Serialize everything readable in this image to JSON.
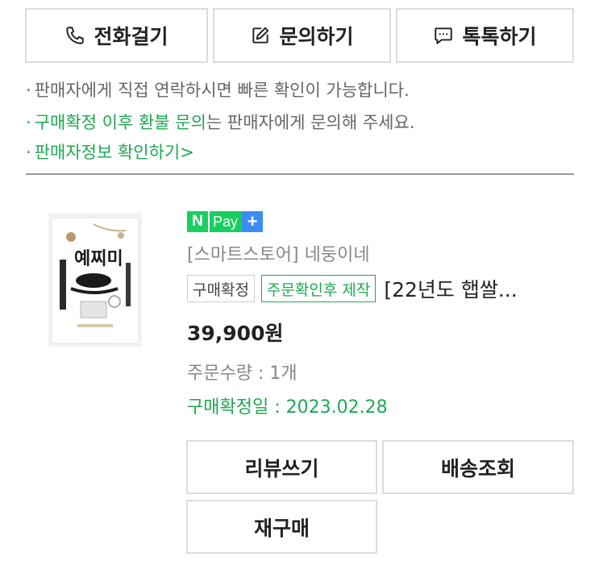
{
  "top_actions": {
    "call_label": "전화걸기",
    "inquiry_label": "문의하기",
    "talktalk_label": "톡톡하기"
  },
  "notes": {
    "line1": "판매자에게 직접 연락하시면 빠른 확인이 가능합니다.",
    "line2_highlight": "구매확정 이후 환불 문의",
    "line2_rest": "는 판매자에게 문의해 주세요.",
    "seller_info_link": "판매자정보 확인하기",
    "bullet": "·",
    "chevron": ">"
  },
  "order": {
    "npay_n": "N",
    "npay_pay": "Pay",
    "npay_plus": "+",
    "store": "[스마트스토어] 네둥이네",
    "badge_confirmed": "구매확정",
    "badge_made_to_order": "주문확인후 제작",
    "product_title": "[22년도 햅쌀...",
    "price": "39,900원",
    "quantity": "주문수량 : 1개",
    "confirm_date": "구매확정일 : 2023.02.28",
    "product_image_text": "예찌미",
    "brand_color": "#1fa752"
  },
  "order_actions": {
    "review_label": "리뷰쓰기",
    "tracking_label": "배송조회",
    "rebuy_label": "재구매"
  }
}
